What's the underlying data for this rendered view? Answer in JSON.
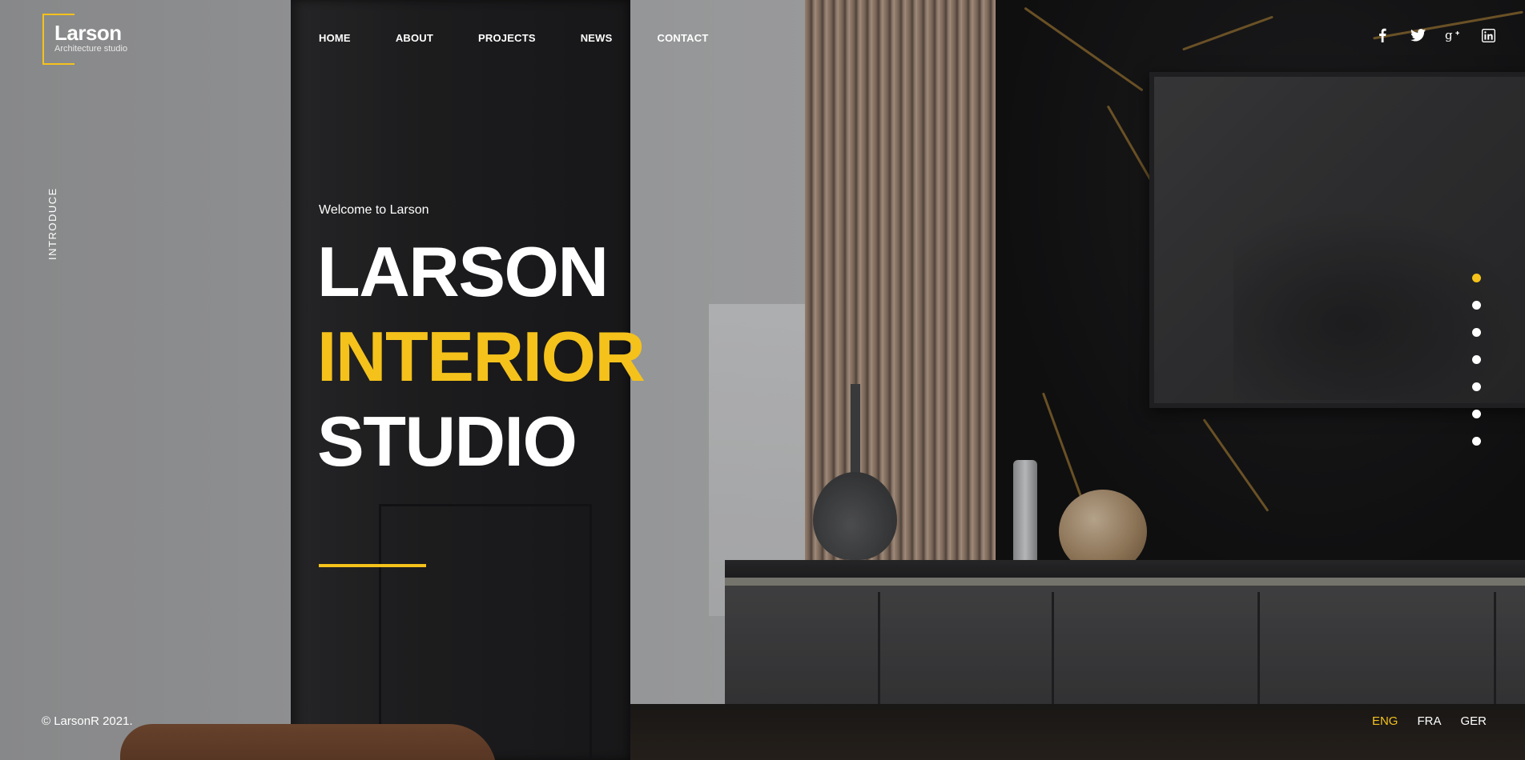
{
  "brand": {
    "name": "Larson",
    "tagline": "Architecture studio",
    "accent_color": "#f5c21b"
  },
  "nav": {
    "items": [
      {
        "label": "HOME"
      },
      {
        "label": "ABOUT"
      },
      {
        "label": "PROJECTS"
      },
      {
        "label": "NEWS"
      },
      {
        "label": "CONTACT"
      }
    ]
  },
  "social": {
    "icons": [
      "facebook-icon",
      "twitter-icon",
      "google-plus-icon",
      "linkedin-icon"
    ]
  },
  "side": {
    "label": "INTRODUCE"
  },
  "hero": {
    "welcome": "Welcome to Larson",
    "line1": "LARSON",
    "line2": "INTERIOR",
    "line3": "STUDIO"
  },
  "slider": {
    "count": 7,
    "active_index": 0
  },
  "footer": {
    "copyright": "© LarsonR 2021.",
    "languages": [
      {
        "label": "ENG",
        "active": true
      },
      {
        "label": "FRA",
        "active": false
      },
      {
        "label": "GER",
        "active": false
      }
    ]
  }
}
